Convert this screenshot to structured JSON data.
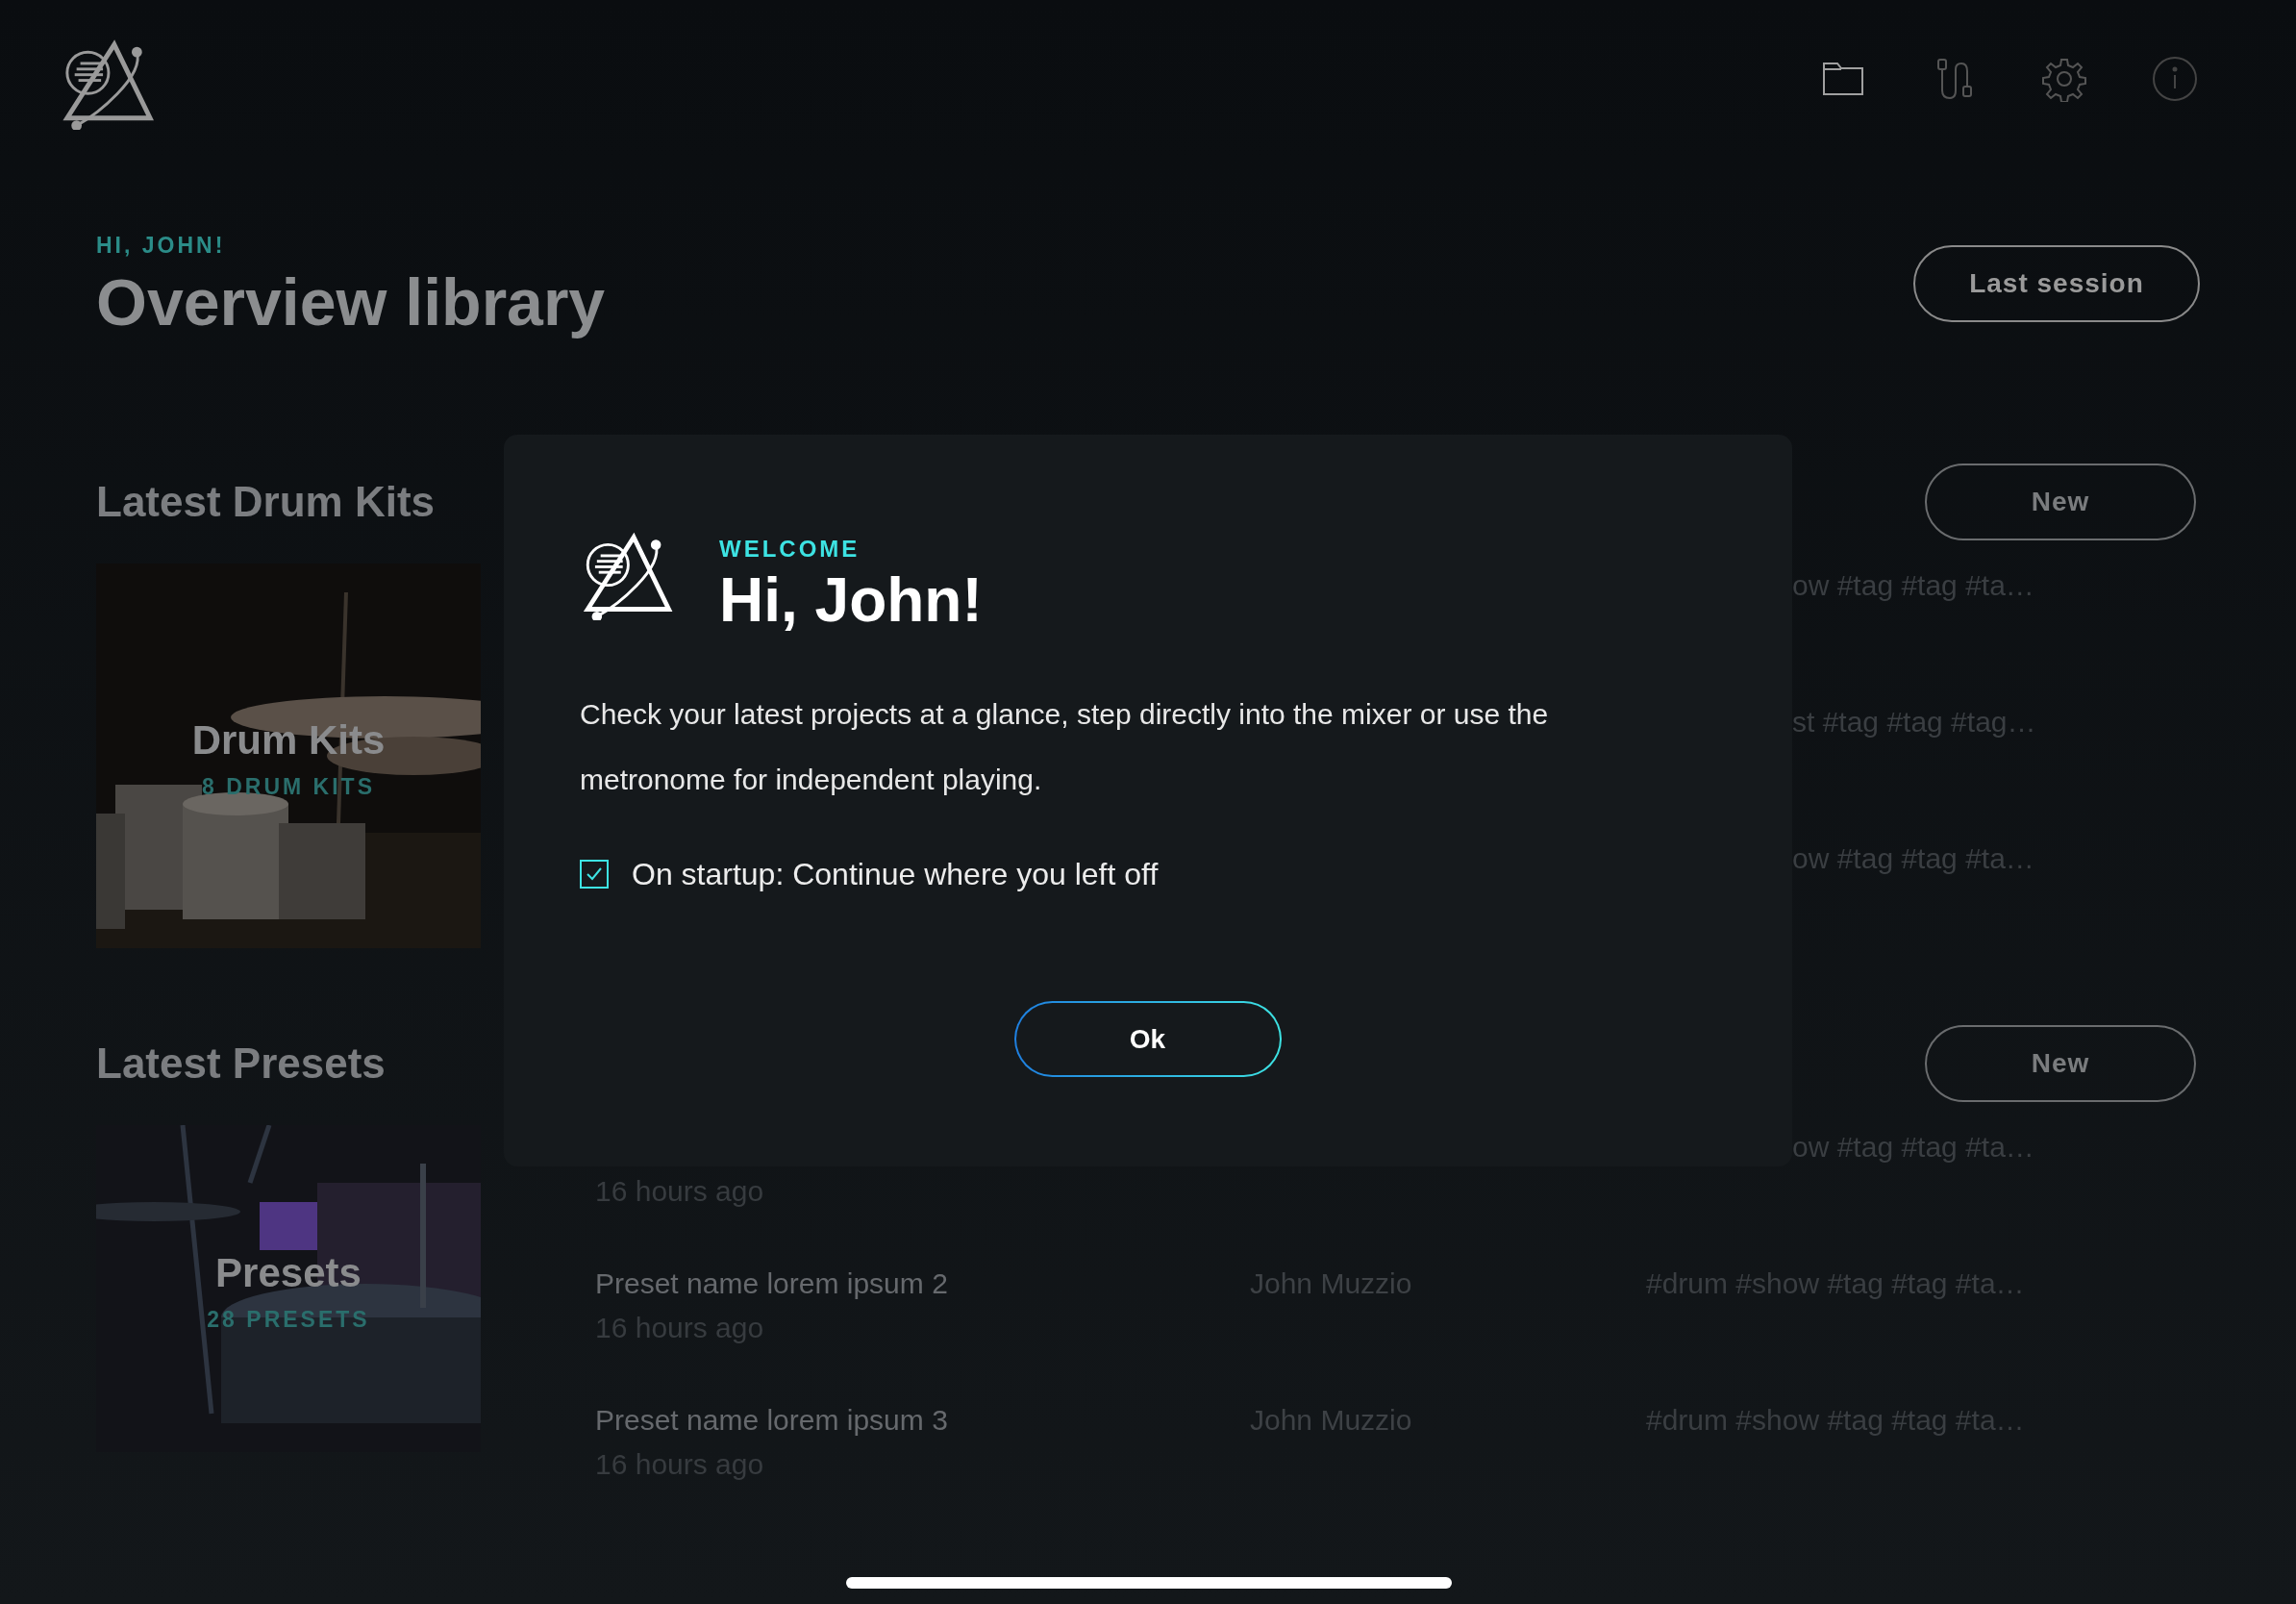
{
  "header": {
    "greeting": "HI, JOHN!",
    "title": "Overview library",
    "last_session_button": "Last session"
  },
  "sections": [
    {
      "title": "Latest Drum Kits",
      "new_button": "New",
      "card": {
        "kind": "picture",
        "title": "Drum Kits",
        "count": "8 DRUM KITS"
      },
      "rows": [
        {
          "tags": "ow #tag #tag #ta…"
        },
        {
          "tags": "st #tag #tag #tag…"
        },
        {
          "tags": "ow #tag #tag #ta…"
        }
      ]
    },
    {
      "title": "Latest Presets",
      "new_button": "New",
      "card": {
        "kind": "picture",
        "title": "Presets",
        "count": "28 PRESETS"
      },
      "rows": [
        {
          "tags": "ow #tag #tag #ta…",
          "time": "16 hours ago"
        },
        {
          "name": "Preset name lorem ipsum 2",
          "author": "John Muzzio",
          "tags": "#drum #show #tag #tag #ta…",
          "time": "16 hours ago"
        },
        {
          "name": "Preset name lorem ipsum 3",
          "author": "John Muzzio",
          "tags": "#drum #show #tag #tag #ta…",
          "time": "16 hours ago"
        }
      ]
    }
  ],
  "dialog": {
    "eyebrow": "WELCOME",
    "title": "Hi, John!",
    "message": "Check your latest projects at a glance, step directly into the mixer or use the metronome for independent playing.",
    "checkbox": {
      "label": "On startup: Continue where you left off",
      "checked": true
    },
    "ok_button": "Ok"
  }
}
